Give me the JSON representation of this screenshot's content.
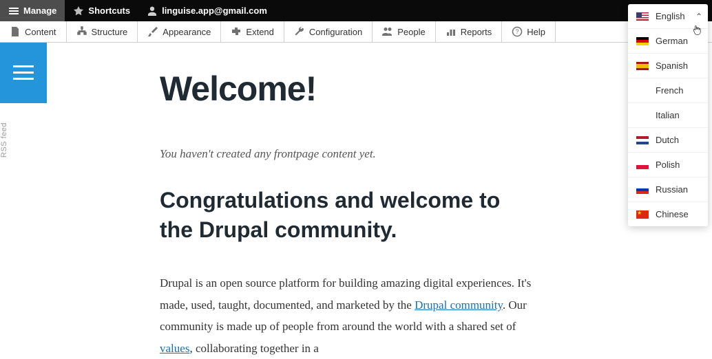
{
  "topbar": {
    "manage": "Manage",
    "shortcuts": "Shortcuts",
    "user_email": "linguise.app@gmail.com"
  },
  "secbar": {
    "content": "Content",
    "structure": "Structure",
    "appearance": "Appearance",
    "extend": "Extend",
    "configuration": "Configuration",
    "people": "People",
    "reports": "Reports",
    "help": "Help"
  },
  "rss_label": "RSS feed",
  "main": {
    "title": "Welcome!",
    "no_content": "You haven't created any frontpage content yet.",
    "congrats": "Congratulations and welcome to the Drupal community.",
    "para_a": "Drupal is an open source platform for building amazing digital experiences. It's made, used, taught, documented, and marketed by the ",
    "link_community": "Drupal community",
    "para_b": ". Our community is made up of people from around the world with a shared set of ",
    "link_values": "values",
    "para_c": ", collaborating together in a"
  },
  "lang": {
    "items": [
      {
        "label": "English",
        "flag": "flag-us"
      },
      {
        "label": "German",
        "flag": "flag-de"
      },
      {
        "label": "Spanish",
        "flag": "flag-es"
      },
      {
        "label": "French",
        "flag": "flag-fr"
      },
      {
        "label": "Italian",
        "flag": "flag-it"
      },
      {
        "label": "Dutch",
        "flag": "flag-nl"
      },
      {
        "label": "Polish",
        "flag": "flag-pl"
      },
      {
        "label": "Russian",
        "flag": "flag-ru"
      },
      {
        "label": "Chinese",
        "flag": "flag-cn"
      }
    ]
  }
}
